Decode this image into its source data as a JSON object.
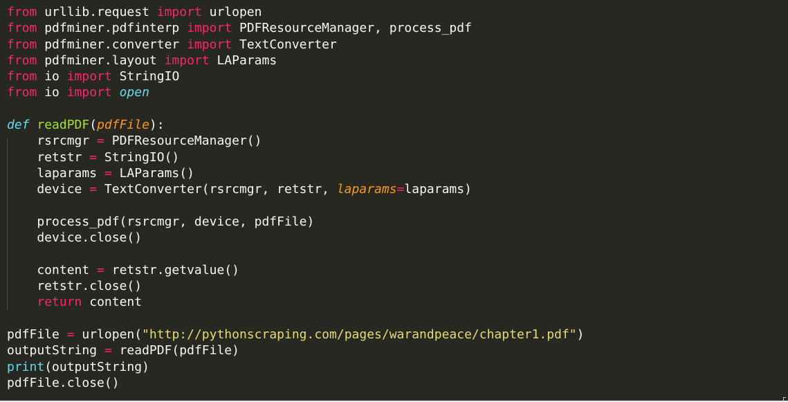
{
  "editor": {
    "language": "python",
    "theme": "monokai",
    "colors": {
      "background": "#272822",
      "text": "#f8f8f2",
      "keyword": "#f92672",
      "function": "#a6e22e",
      "string": "#e6db74",
      "builtin": "#66d9ef",
      "parameter": "#fd971f"
    },
    "lines": [
      [
        {
          "t": "from",
          "c": "kw"
        },
        {
          "t": " urllib.request ",
          "c": "tx"
        },
        {
          "t": "import",
          "c": "kw"
        },
        {
          "t": " urlopen",
          "c": "tx"
        }
      ],
      [
        {
          "t": "from",
          "c": "kw"
        },
        {
          "t": " pdfminer.pdfinterp ",
          "c": "tx"
        },
        {
          "t": "import",
          "c": "kw"
        },
        {
          "t": " PDFResourceManager, process_pdf",
          "c": "tx"
        }
      ],
      [
        {
          "t": "from",
          "c": "kw"
        },
        {
          "t": " pdfminer.converter ",
          "c": "tx"
        },
        {
          "t": "import",
          "c": "kw"
        },
        {
          "t": " TextConverter",
          "c": "tx"
        }
      ],
      [
        {
          "t": "from",
          "c": "kw"
        },
        {
          "t": " pdfminer.layout ",
          "c": "tx"
        },
        {
          "t": "import",
          "c": "kw"
        },
        {
          "t": " LAParams",
          "c": "tx"
        }
      ],
      [
        {
          "t": "from",
          "c": "kw"
        },
        {
          "t": " io ",
          "c": "tx"
        },
        {
          "t": "import",
          "c": "kw"
        },
        {
          "t": " StringIO",
          "c": "tx"
        }
      ],
      [
        {
          "t": "from",
          "c": "kw"
        },
        {
          "t": " io ",
          "c": "tx"
        },
        {
          "t": "import",
          "c": "kw"
        },
        {
          "t": " ",
          "c": "tx"
        },
        {
          "t": "open",
          "c": "bi it"
        }
      ],
      [],
      [
        {
          "t": "def",
          "c": "bi it"
        },
        {
          "t": " ",
          "c": "tx"
        },
        {
          "t": "readPDF",
          "c": "fn"
        },
        {
          "t": "(",
          "c": "tx"
        },
        {
          "t": "pdfFile",
          "c": "pa"
        },
        {
          "t": "):",
          "c": "tx"
        }
      ],
      [
        {
          "t": "    rsrcmgr ",
          "c": "tx"
        },
        {
          "t": "=",
          "c": "kw"
        },
        {
          "t": " PDFResourceManager()",
          "c": "tx"
        }
      ],
      [
        {
          "t": "    retstr ",
          "c": "tx"
        },
        {
          "t": "=",
          "c": "kw"
        },
        {
          "t": " StringIO()",
          "c": "tx"
        }
      ],
      [
        {
          "t": "    laparams ",
          "c": "tx"
        },
        {
          "t": "=",
          "c": "kw"
        },
        {
          "t": " LAParams()",
          "c": "tx"
        }
      ],
      [
        {
          "t": "    device ",
          "c": "tx"
        },
        {
          "t": "=",
          "c": "kw"
        },
        {
          "t": " TextConverter(rsrcmgr, retstr, ",
          "c": "tx"
        },
        {
          "t": "laparams",
          "c": "pa"
        },
        {
          "t": "=",
          "c": "kw"
        },
        {
          "t": "laparams)",
          "c": "tx"
        }
      ],
      [],
      [
        {
          "t": "    process_pdf(rsrcmgr, device, pdfFile)",
          "c": "tx"
        }
      ],
      [
        {
          "t": "    device.close()",
          "c": "tx"
        }
      ],
      [],
      [
        {
          "t": "    content ",
          "c": "tx"
        },
        {
          "t": "=",
          "c": "kw"
        },
        {
          "t": " retstr.getvalue()",
          "c": "tx"
        }
      ],
      [
        {
          "t": "    retstr.close()",
          "c": "tx"
        }
      ],
      [
        {
          "t": "    ",
          "c": "tx"
        },
        {
          "t": "return",
          "c": "kw"
        },
        {
          "t": " content",
          "c": "tx"
        }
      ],
      [],
      [
        {
          "t": "pdfFile ",
          "c": "tx"
        },
        {
          "t": "=",
          "c": "kw"
        },
        {
          "t": " urlopen(",
          "c": "tx"
        },
        {
          "t": "\"http://pythonscraping.com/pages/warandpeace/chapter1.pdf\"",
          "c": "st"
        },
        {
          "t": ")",
          "c": "tx"
        }
      ],
      [
        {
          "t": "outputString ",
          "c": "tx"
        },
        {
          "t": "=",
          "c": "kw"
        },
        {
          "t": " readPDF(pdfFile)",
          "c": "tx"
        }
      ],
      [
        {
          "t": "print",
          "c": "bi"
        },
        {
          "t": "(outputString)",
          "c": "tx"
        }
      ],
      [
        {
          "t": "pdfFile.close()",
          "c": "tx"
        }
      ]
    ]
  }
}
